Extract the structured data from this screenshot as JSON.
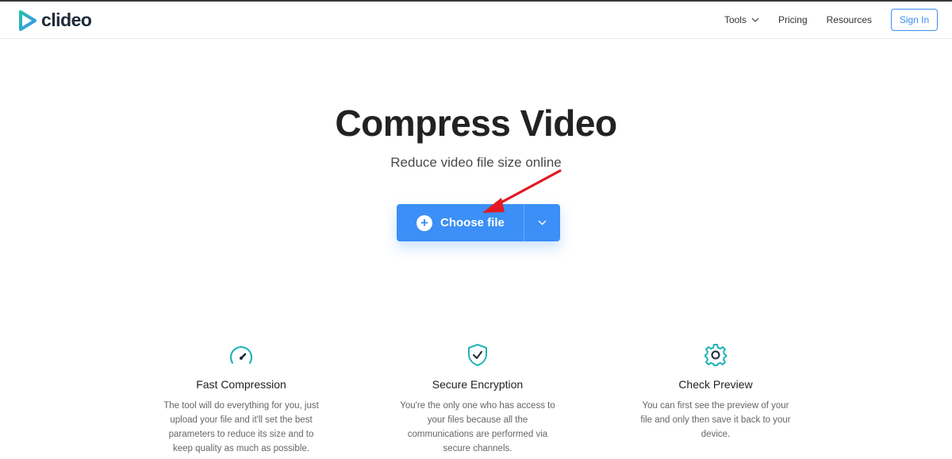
{
  "brand": {
    "name": "clideo",
    "accent": "#3b8ff6",
    "logo_icon": "play-triangle-icon"
  },
  "nav": {
    "tools": "Tools",
    "pricing": "Pricing",
    "resources": "Resources",
    "sign_in": "Sign In"
  },
  "hero": {
    "title": "Compress Video",
    "subtitle": "Reduce video file size online",
    "choose_file": "Choose file"
  },
  "features": [
    {
      "icon": "speedometer-icon",
      "title": "Fast Compression",
      "text": "The tool will do everything for you, just upload your file and it'll set the best parameters to reduce its size and to keep quality as much as possible."
    },
    {
      "icon": "shield-check-icon",
      "title": "Secure Encryption",
      "text": "You're the only one who has access to your files because all the communications are performed via secure channels."
    },
    {
      "icon": "gear-icon",
      "title": "Check Preview",
      "text": "You can first see the preview of your file and only then save it back to your device."
    }
  ]
}
